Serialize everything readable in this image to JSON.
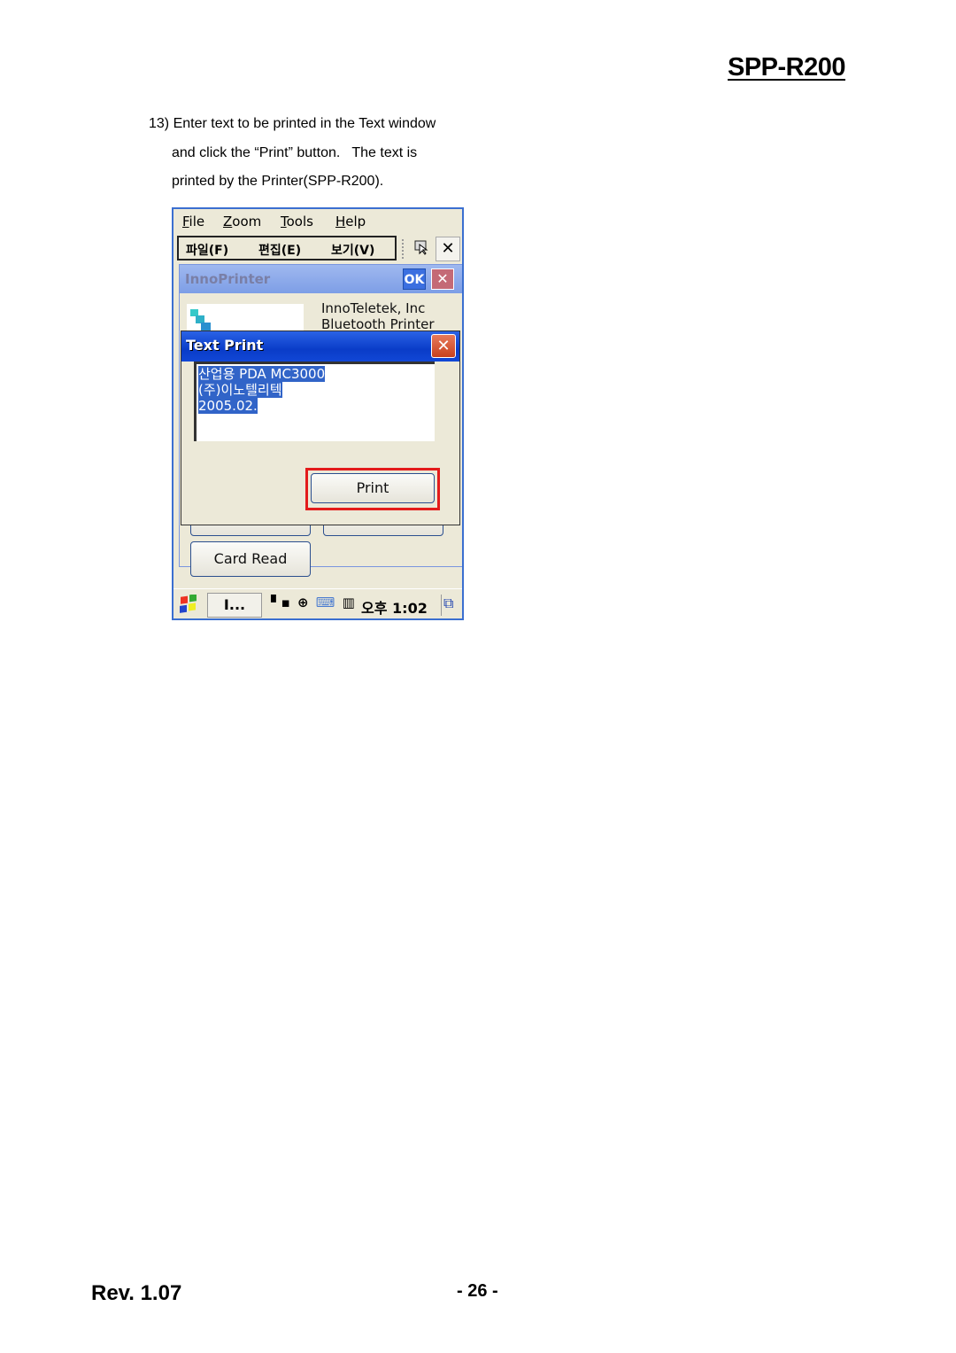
{
  "document": {
    "title": "SPP-R200",
    "step_lines": [
      "13) Enter text to be printed in the Text window",
      "and click the “Print” button.   The text is",
      "printed by the Printer(SPP-R200)."
    ],
    "footer_rev": "Rev. 1.07",
    "footer_page": "- 26 -"
  },
  "pda": {
    "menubar": [
      {
        "label": "File",
        "mnemonic": "F"
      },
      {
        "label": "Zoom",
        "mnemonic": "Z"
      },
      {
        "label": "Tools",
        "mnemonic": "T"
      },
      {
        "label": "Help",
        "mnemonic": "H"
      }
    ],
    "toolbar": [
      "파일(F)",
      "편집(E)",
      "보기(V)"
    ],
    "toolbar_close": "✕",
    "app_window": {
      "title": "InnoPrinter",
      "ok_label": "OK",
      "close_label": "✕",
      "company": "InnoTeletek, Inc",
      "product": "Bluetooth Printer",
      "card_read_label": "Card Read"
    },
    "text_print_dialog": {
      "title": "Text Print",
      "close_label": "✕",
      "text_lines": [
        "산업용 PDA MC3000",
        "(주)이노텔리텍",
        "2005.02."
      ],
      "print_label": "Print",
      "highlight_color": "#e31b1b"
    },
    "taskbar": {
      "task_label": "I...",
      "ampm": "오후",
      "time": "1:02",
      "tray_icons": [
        "signal-icon",
        "ie-icon",
        "network-icon",
        "input-method-icon"
      ]
    }
  }
}
